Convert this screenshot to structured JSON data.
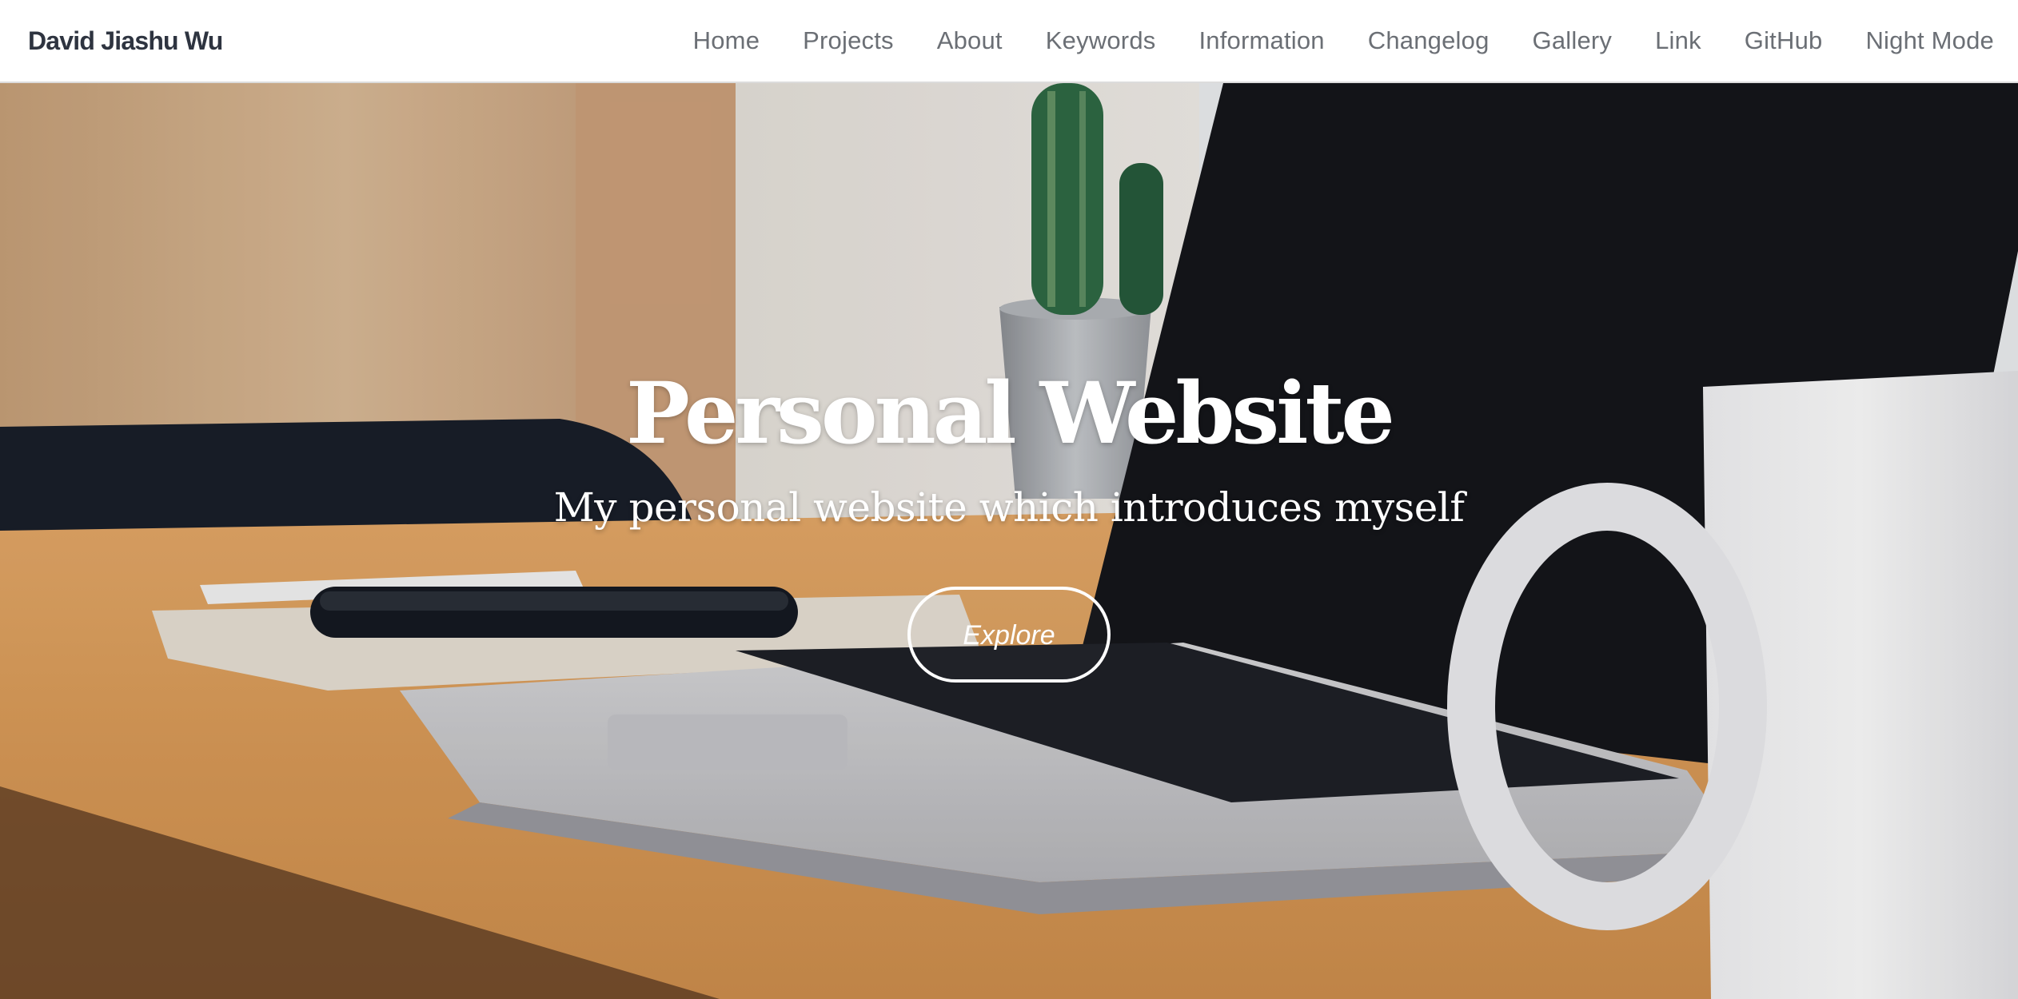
{
  "navbar": {
    "brand": "David Jiashu Wu",
    "links": [
      {
        "label": "Home"
      },
      {
        "label": "Projects"
      },
      {
        "label": "About"
      },
      {
        "label": "Keywords"
      },
      {
        "label": "Information"
      },
      {
        "label": "Changelog"
      },
      {
        "label": "Gallery"
      },
      {
        "label": "Link"
      },
      {
        "label": "GitHub"
      },
      {
        "label": "Night Mode"
      }
    ]
  },
  "hero": {
    "title": "Personal Website",
    "subtitle": "My personal website which introduces myself",
    "explore_label": "Explore",
    "background_image": "desk-with-laptop-phone-mug-cactus"
  },
  "colors": {
    "nav_background": "#ffffff",
    "brand_text": "#2e3440",
    "nav_link_text": "#6b6f75",
    "hero_text": "#ffffff",
    "desk_wood": "#d39a58"
  }
}
